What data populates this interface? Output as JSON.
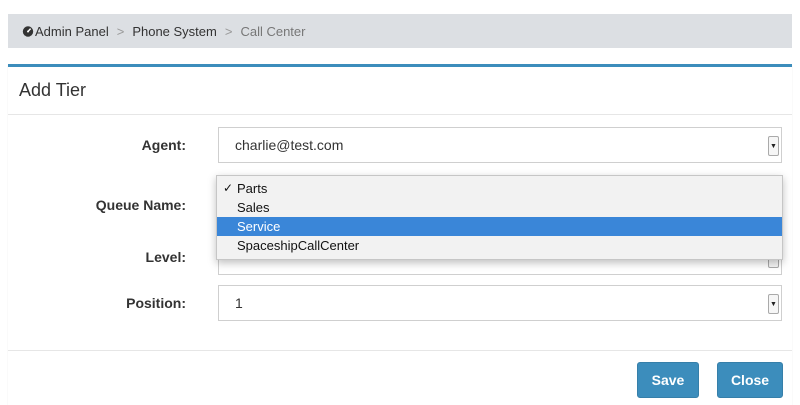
{
  "breadcrumb": {
    "items": [
      "Admin Panel",
      "Phone System",
      "Call Center"
    ],
    "separator": ">"
  },
  "panel": {
    "title": "Add Tier"
  },
  "form": {
    "agent": {
      "label": "Agent:",
      "value": "charlie@test.com"
    },
    "queue_name": {
      "label": "Queue Name:"
    },
    "level": {
      "label": "Level:"
    },
    "position": {
      "label": "Position:",
      "value": "1"
    }
  },
  "queue_dropdown": {
    "options": [
      "Parts",
      "Sales",
      "Service",
      "SpaceshipCallCenter"
    ],
    "checked": "Parts",
    "highlighted": "Service"
  },
  "buttons": {
    "save": "Save",
    "close": "Close"
  },
  "colors": {
    "accent": "#3c8dbc",
    "breadcrumb_bg": "#dcdfe3",
    "dropdown_highlight": "#3a86d8"
  }
}
